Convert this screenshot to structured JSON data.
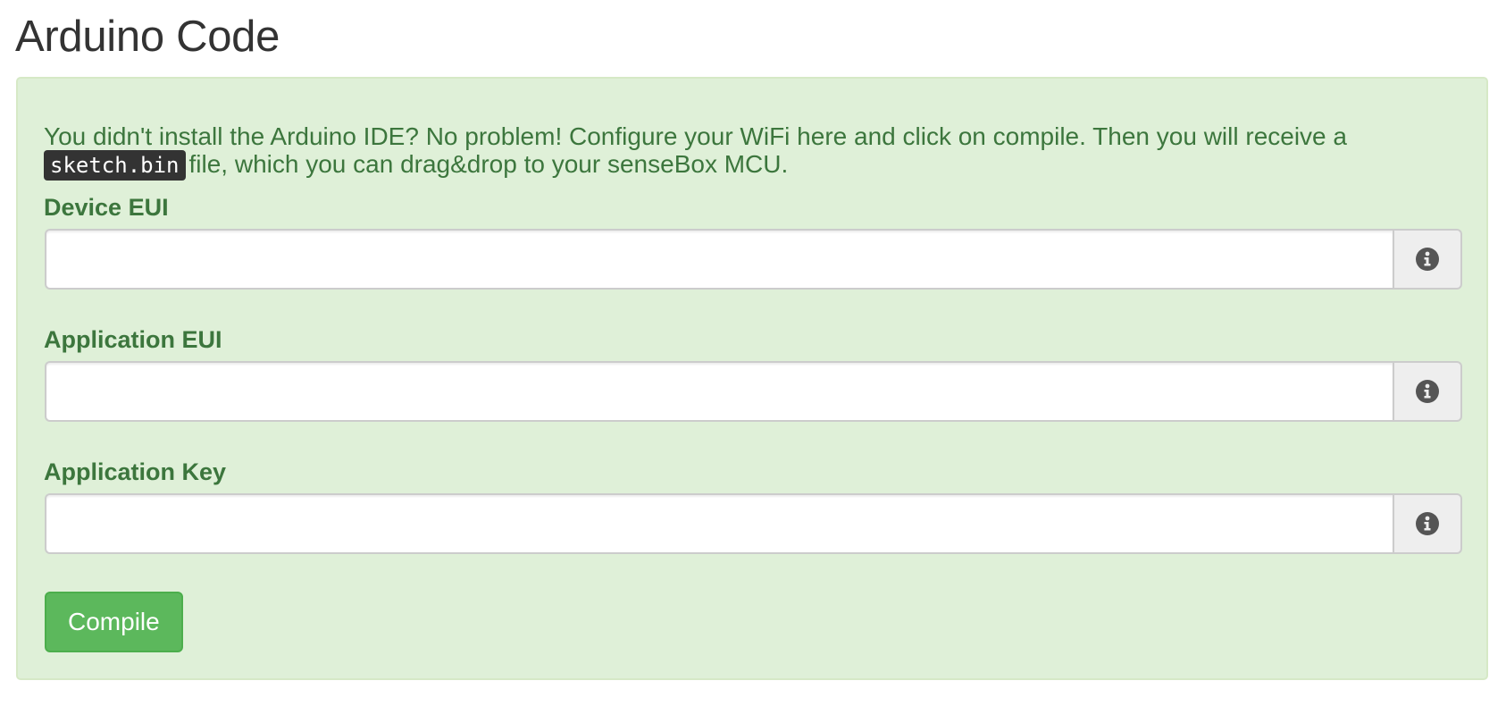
{
  "page": {
    "title": "Arduino Code"
  },
  "panel": {
    "intro_before": "You didn't install the Arduino IDE? No problem! Configure your WiFi here and click on compile. Then you will receive a",
    "intro_code": "sketch.bin",
    "intro_after": "file, which you can drag&drop to your senseBox MCU."
  },
  "fields": [
    {
      "label": "Device EUI",
      "value": "",
      "icon": "info-circle-icon"
    },
    {
      "label": "Application EUI",
      "value": "",
      "icon": "info-circle-icon"
    },
    {
      "label": "Application Key",
      "value": "",
      "icon": "info-circle-icon"
    }
  ],
  "actions": {
    "compile_label": "Compile"
  },
  "colors": {
    "panel_background": "#dff0d8",
    "panel_text": "#3c763d",
    "button_green": "#5cb85c",
    "code_background": "#333333",
    "icon_gray": "#555555"
  }
}
